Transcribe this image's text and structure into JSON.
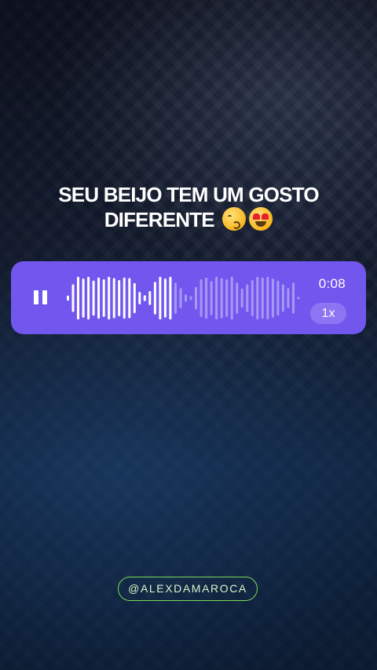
{
  "title": {
    "line1": "SEU BEIJO TEM UM GOSTO",
    "line2": "DIFERENTE",
    "emojis": [
      "kissing-face-with-smiling-eyes",
      "smiling-face-with-heart-eyes"
    ]
  },
  "player": {
    "time": "0:08",
    "speed": "1x",
    "progress": 0.45,
    "accent_color": "#7257ef",
    "played_color": "#ffffff",
    "unplayed_color": "#a898f5",
    "waveform": [
      0.1,
      0.55,
      0.85,
      0.78,
      0.85,
      0.7,
      0.82,
      0.75,
      0.85,
      0.8,
      0.72,
      0.82,
      0.8,
      0.6,
      0.25,
      0.12,
      0.28,
      0.65,
      0.85,
      0.78,
      0.85,
      0.62,
      0.4,
      0.15,
      0.08,
      0.45,
      0.75,
      0.82,
      0.68,
      0.85,
      0.8,
      0.75,
      0.85,
      0.62,
      0.38,
      0.55,
      0.72,
      0.85,
      0.82,
      0.85,
      0.78,
      0.7,
      0.55,
      0.4,
      0.62,
      0.05
    ]
  },
  "footer": {
    "handle": "@ALEXDAMAROCA"
  }
}
